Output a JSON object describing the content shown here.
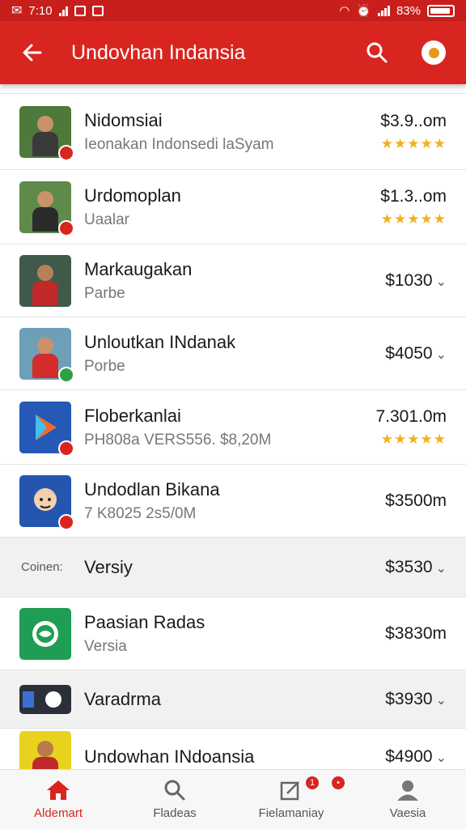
{
  "status_bar": {
    "time": "7:10",
    "battery": "83%"
  },
  "app_bar": {
    "title": "Undovhan Indansia"
  },
  "rows": [
    {
      "name": "Nidomsiai",
      "subtitle": "Ieonakan Indonsedi laSyam",
      "price": "$3.9..om",
      "rating": "★★★★★"
    },
    {
      "name": "Urdomoplan",
      "subtitle": "Uaalar",
      "price": "$1.3..om",
      "rating": "★★★★★"
    },
    {
      "name": "Markaugakan",
      "subtitle": "Parbe",
      "price": "$1030"
    },
    {
      "name": "Unloutkan INdanak",
      "subtitle": "Porbe",
      "price": "$4050"
    },
    {
      "name": "Floberkanlai",
      "subtitle": "PH808a VERS556. $8,20M",
      "price": "7.301.0m",
      "rating": "★★★★★"
    },
    {
      "name": "Undodlan Bikana",
      "subtitle": "7 K8025 2s5/0M",
      "price": "$3500m"
    },
    {
      "side_label": "Coinen:",
      "name": "Versiy",
      "price": "$3530"
    },
    {
      "name": "Paasian Radas",
      "subtitle": "Versia",
      "price": "$3830m"
    },
    {
      "name": "Varadrma",
      "price": "$3930"
    },
    {
      "name": "Undowhan INdoansia",
      "price": "$4900"
    }
  ],
  "bottom_nav": [
    {
      "label": "Aldemart",
      "badge": ""
    },
    {
      "label": "Fladeas",
      "badge": ""
    },
    {
      "label": "Fielamaniay",
      "badge": "1"
    },
    {
      "label": "Vaesia",
      "badge": ""
    }
  ],
  "colors": {
    "primary": "#d9251f",
    "status_bar": "#c81f1c",
    "star": "#f2b01e"
  }
}
